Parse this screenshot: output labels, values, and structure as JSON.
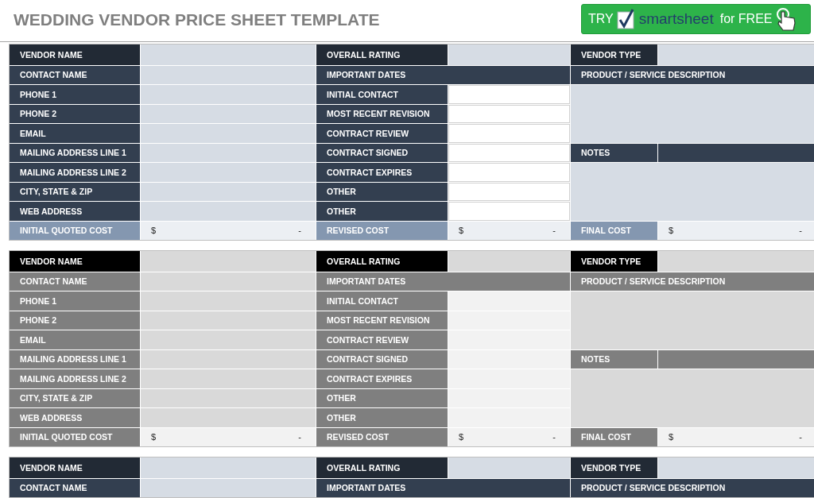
{
  "title": "WEDDING VENDOR PRICE SHEET TEMPLATE",
  "promo": {
    "try": "TRY",
    "brand": "smartsheet",
    "offer": "for FREE"
  },
  "blocks": [
    {
      "kind": "navy",
      "cells": [
        {
          "kind": "head",
          "text": "VENDOR NAME"
        },
        {
          "kind": "field"
        },
        {
          "kind": "head",
          "text": "OVERALL RATING"
        },
        {
          "kind": "field"
        },
        {
          "kind": "head",
          "text": "VENDOR TYPE"
        },
        {
          "kind": "field"
        },
        {
          "kind": "label",
          "text": "CONTACT NAME"
        },
        {
          "kind": "field"
        },
        {
          "kind": "label-wide",
          "text": "IMPORTANT DATES"
        },
        {
          "kind": "label-wide",
          "text": "PRODUCT / SERVICE DESCRIPTION"
        },
        {
          "kind": "label",
          "text": "PHONE 1"
        },
        {
          "kind": "field"
        },
        {
          "kind": "label",
          "text": "INITIAL CONTACT"
        },
        {
          "kind": "field-light"
        },
        {
          "kind": "area"
        },
        {
          "kind": "label",
          "text": "PHONE 2"
        },
        {
          "kind": "field"
        },
        {
          "kind": "label",
          "text": "MOST RECENT REVISION"
        },
        {
          "kind": "field-light"
        },
        {
          "kind": "label",
          "text": "EMAIL"
        },
        {
          "kind": "field"
        },
        {
          "kind": "label",
          "text": "CONTRACT REVIEW"
        },
        {
          "kind": "field-light"
        },
        {
          "kind": "label",
          "text": "MAILING ADDRESS LINE 1"
        },
        {
          "kind": "field"
        },
        {
          "kind": "label",
          "text": "CONTRACT SIGNED"
        },
        {
          "kind": "field-light"
        },
        {
          "kind": "label",
          "text": "NOTES"
        },
        {
          "kind": "label-fill"
        },
        {
          "kind": "label",
          "text": "MAILING ADDRESS LINE 2"
        },
        {
          "kind": "field"
        },
        {
          "kind": "label",
          "text": "CONTRACT EXPIRES"
        },
        {
          "kind": "field-light"
        },
        {
          "kind": "area"
        },
        {
          "kind": "label",
          "text": "CITY, STATE & ZIP"
        },
        {
          "kind": "field"
        },
        {
          "kind": "label",
          "text": "OTHER"
        },
        {
          "kind": "field-light"
        },
        {
          "kind": "label",
          "text": "WEB ADDRESS"
        },
        {
          "kind": "field"
        },
        {
          "kind": "label",
          "text": "OTHER"
        },
        {
          "kind": "field-light"
        },
        {
          "kind": "cost-label",
          "text": "INITIAL QUOTED COST"
        },
        {
          "kind": "cost",
          "currency": "$",
          "value": "-"
        },
        {
          "kind": "cost-label",
          "text": "REVISED COST"
        },
        {
          "kind": "cost",
          "currency": "$",
          "value": "-"
        },
        {
          "kind": "cost-label",
          "text": "FINAL COST"
        },
        {
          "kind": "cost",
          "currency": "$",
          "value": "-"
        }
      ]
    },
    {
      "kind": "gray",
      "cells": [
        {
          "kind": "head",
          "text": "VENDOR NAME"
        },
        {
          "kind": "field"
        },
        {
          "kind": "head",
          "text": "OVERALL RATING"
        },
        {
          "kind": "field"
        },
        {
          "kind": "head",
          "text": "VENDOR TYPE"
        },
        {
          "kind": "field"
        },
        {
          "kind": "label",
          "text": "CONTACT NAME"
        },
        {
          "kind": "field"
        },
        {
          "kind": "label-wide",
          "text": "IMPORTANT DATES"
        },
        {
          "kind": "label-wide",
          "text": "PRODUCT / SERVICE DESCRIPTION"
        },
        {
          "kind": "label",
          "text": "PHONE 1"
        },
        {
          "kind": "field"
        },
        {
          "kind": "label",
          "text": "INITIAL CONTACT"
        },
        {
          "kind": "field-light"
        },
        {
          "kind": "area"
        },
        {
          "kind": "label",
          "text": "PHONE 2"
        },
        {
          "kind": "field"
        },
        {
          "kind": "label",
          "text": "MOST RECENT REVISION"
        },
        {
          "kind": "field-light"
        },
        {
          "kind": "label",
          "text": "EMAIL"
        },
        {
          "kind": "field"
        },
        {
          "kind": "label",
          "text": "CONTRACT REVIEW"
        },
        {
          "kind": "field-light"
        },
        {
          "kind": "label",
          "text": "MAILING ADDRESS LINE 1"
        },
        {
          "kind": "field"
        },
        {
          "kind": "label",
          "text": "CONTRACT SIGNED"
        },
        {
          "kind": "field-light"
        },
        {
          "kind": "label",
          "text": "NOTES"
        },
        {
          "kind": "label-fill"
        },
        {
          "kind": "label",
          "text": "MAILING ADDRESS LINE 2"
        },
        {
          "kind": "field"
        },
        {
          "kind": "label",
          "text": "CONTRACT EXPIRES"
        },
        {
          "kind": "field-light"
        },
        {
          "kind": "area"
        },
        {
          "kind": "label",
          "text": "CITY, STATE & ZIP"
        },
        {
          "kind": "field"
        },
        {
          "kind": "label",
          "text": "OTHER"
        },
        {
          "kind": "field-light"
        },
        {
          "kind": "label",
          "text": "WEB ADDRESS"
        },
        {
          "kind": "field"
        },
        {
          "kind": "label",
          "text": "OTHER"
        },
        {
          "kind": "field-light"
        },
        {
          "kind": "cost-label",
          "text": "INITIAL QUOTED COST"
        },
        {
          "kind": "cost",
          "currency": "$",
          "value": "-"
        },
        {
          "kind": "cost-label",
          "text": "REVISED COST"
        },
        {
          "kind": "cost",
          "currency": "$",
          "value": "-"
        },
        {
          "kind": "cost-label",
          "text": "FINAL COST"
        },
        {
          "kind": "cost",
          "currency": "$",
          "value": "-"
        }
      ]
    },
    {
      "kind": "navy",
      "cells": [
        {
          "kind": "head",
          "text": "VENDOR NAME"
        },
        {
          "kind": "field"
        },
        {
          "kind": "head",
          "text": "OVERALL RATING"
        },
        {
          "kind": "field"
        },
        {
          "kind": "head",
          "text": "VENDOR TYPE"
        },
        {
          "kind": "field"
        },
        {
          "kind": "label",
          "text": "CONTACT NAME"
        },
        {
          "kind": "field"
        },
        {
          "kind": "label-wide",
          "text": "IMPORTANT DATES"
        },
        {
          "kind": "label-wide",
          "text": "PRODUCT / SERVICE DESCRIPTION"
        }
      ]
    }
  ]
}
